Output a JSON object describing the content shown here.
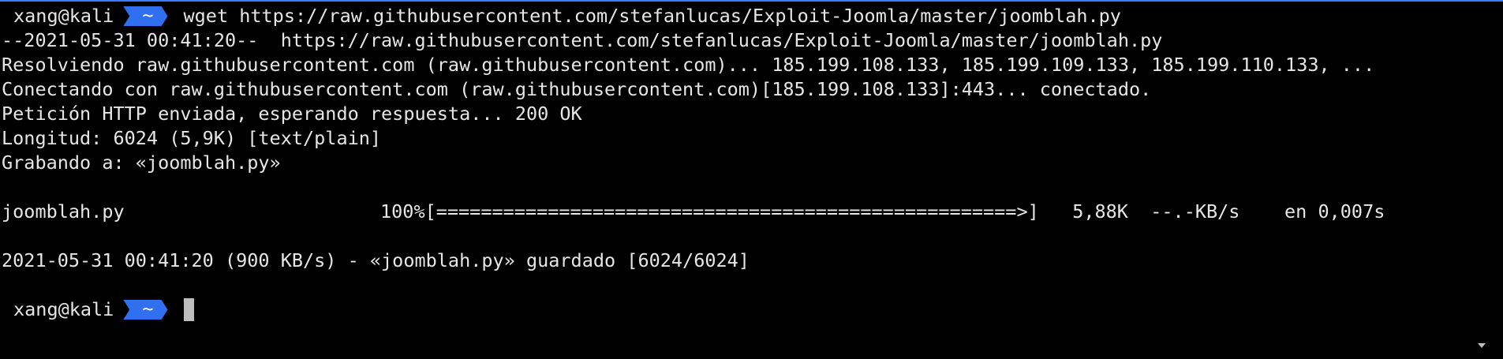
{
  "prompt": {
    "user_host": "xang@kali",
    "dir": "~"
  },
  "command": "wget https://raw.githubusercontent.com/stefanlucas/Exploit-Joomla/master/joomblah.py",
  "output": [
    "--2021-05-31 00:41:20--  https://raw.githubusercontent.com/stefanlucas/Exploit-Joomla/master/joomblah.py",
    "Resolviendo raw.githubusercontent.com (raw.githubusercontent.com)... 185.199.108.133, 185.199.109.133, 185.199.110.133, ...",
    "Conectando con raw.githubusercontent.com (raw.githubusercontent.com)[185.199.108.133]:443... conectado.",
    "Petición HTTP enviada, esperando respuesta... 200 OK",
    "Longitud: 6024 (5,9K) [text/plain]",
    "Grabando a: «joomblah.py»"
  ],
  "progress": {
    "filename": "joomblah.py",
    "percent_label": "100%",
    "percent": 100,
    "bar": "[====================================================>]",
    "size": "5,88K",
    "speed": "--.-KB/s",
    "time": "en 0,007s"
  },
  "saved_line": "2021-05-31 00:41:20 (900 KB/s) - «joomblah.py» guardado [6024/6024]"
}
